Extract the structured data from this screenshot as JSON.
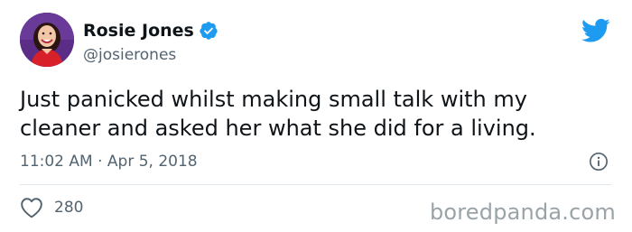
{
  "author": {
    "display_name": "Rosie Jones",
    "handle": "@josierones",
    "verified": true
  },
  "tweet": {
    "text_lines": [
      "Just panicked whilst making small talk with my",
      "cleaner and asked her what she did for a living."
    ],
    "timestamp": "11:02 AM · Apr 5, 2018"
  },
  "actions": {
    "like_count": "280"
  },
  "watermark": "boredpanda.com",
  "colors": {
    "twitter_blue": "#1d9bf0",
    "text_primary": "#0f1419",
    "text_secondary": "#536471",
    "divider": "#e1e8ed"
  },
  "icons": {
    "verified": "verified-badge-icon",
    "brand": "twitter-bird-icon",
    "info": "info-icon",
    "like": "heart-icon"
  }
}
